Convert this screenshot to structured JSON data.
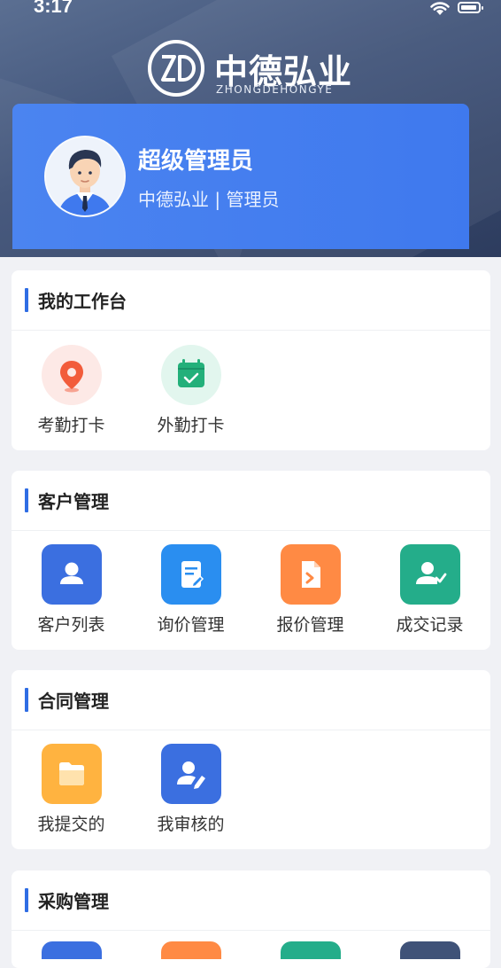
{
  "status": {
    "time": "3:17"
  },
  "brand": {
    "name": "中德弘业",
    "subtitle": "ZHONGDEHONGYE"
  },
  "profile": {
    "name": "超级管理员",
    "role": "中德弘业 | 管理员"
  },
  "sections": [
    {
      "title": "我的工作台",
      "items": [
        {
          "label": "考勤打卡",
          "icon": "location-pin-icon",
          "color": "#f25c3b",
          "bg": "#fde9e6"
        },
        {
          "label": "外勤打卡",
          "icon": "calendar-check-icon",
          "color": "#23b07a",
          "bg": "#e2f6ee"
        }
      ]
    },
    {
      "title": "客户管理",
      "items": [
        {
          "label": "客户列表",
          "icon": "user-icon",
          "color": "#3b6fe0"
        },
        {
          "label": "询价管理",
          "icon": "document-edit-icon",
          "color": "#2a8ef0"
        },
        {
          "label": "报价管理",
          "icon": "file-arrow-icon",
          "color": "#ff8a44"
        },
        {
          "label": "成交记录",
          "icon": "user-check-icon",
          "color": "#24ad8a"
        }
      ]
    },
    {
      "title": "合同管理",
      "items": [
        {
          "label": "我提交的",
          "icon": "folder-icon",
          "color": "#ffb340"
        },
        {
          "label": "我审核的",
          "icon": "user-edit-icon",
          "color": "#3b6fe0"
        }
      ]
    },
    {
      "title": "采购管理",
      "items": []
    }
  ],
  "colors": {
    "accent": "#2f6de4",
    "profile_card": "#4b84f0",
    "page_bg": "#f0f1f5"
  }
}
